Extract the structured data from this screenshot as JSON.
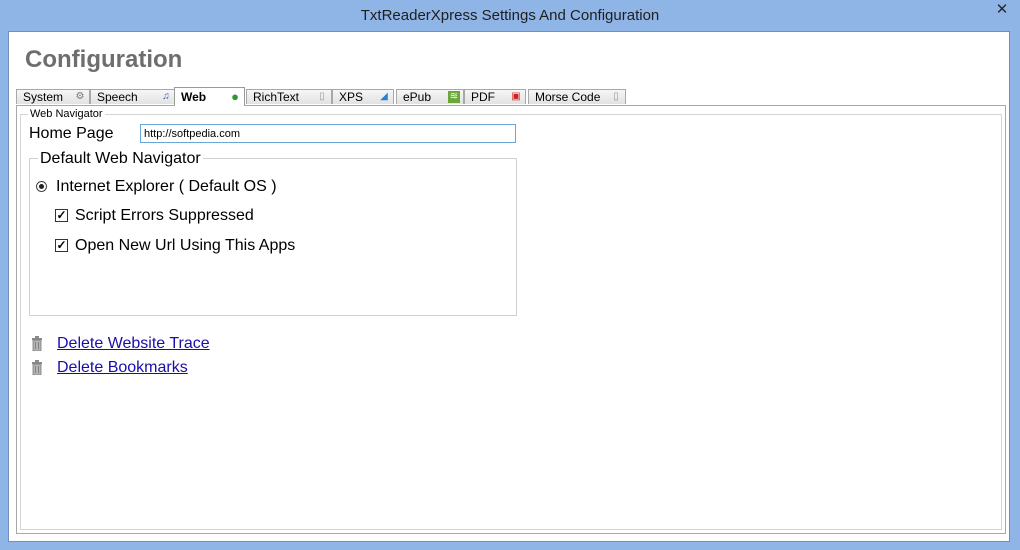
{
  "window": {
    "title": "TxtReaderXpress Settings And Configuration",
    "close_glyph": "✕"
  },
  "header": {
    "title": "Configuration"
  },
  "tabs": [
    {
      "label": "System",
      "icon": "gear-icon",
      "glyph": "⚙",
      "active": false
    },
    {
      "label": "Speech",
      "icon": "speaker-icon",
      "glyph": "♫",
      "active": false
    },
    {
      "label": "Web",
      "icon": "globe-icon",
      "glyph": "●",
      "active": true
    },
    {
      "label": "RichText",
      "icon": "document-icon",
      "glyph": "▯",
      "active": false
    },
    {
      "label": "XPS",
      "icon": "xps-icon",
      "glyph": "◢",
      "active": false
    },
    {
      "label": "ePub",
      "icon": "epub-icon",
      "glyph": "≋",
      "active": false
    },
    {
      "label": "PDF",
      "icon": "pdf-icon",
      "glyph": "▣",
      "active": false
    },
    {
      "label": "Morse Code",
      "icon": "document-icon",
      "glyph": "▯",
      "active": false
    }
  ],
  "web": {
    "section_label": "Web Navigator",
    "home_page_label": "Home Page",
    "home_page_value": "http://softpedia.com",
    "default_group": {
      "legend": "Default Web Navigator",
      "radio_label": "Internet Explorer ( Default OS )",
      "checkbox_1": "Script Errors Suppressed",
      "checkbox_2": "Open New Url Using This Apps",
      "check_glyph": "✓"
    },
    "links": {
      "delete_trace": "Delete Website Trace",
      "delete_bookmarks": "Delete Bookmarks"
    }
  },
  "colors": {
    "window_frame": "#8fb4e6",
    "link": "#1a0dab",
    "title_gray": "#6e6e6e"
  }
}
